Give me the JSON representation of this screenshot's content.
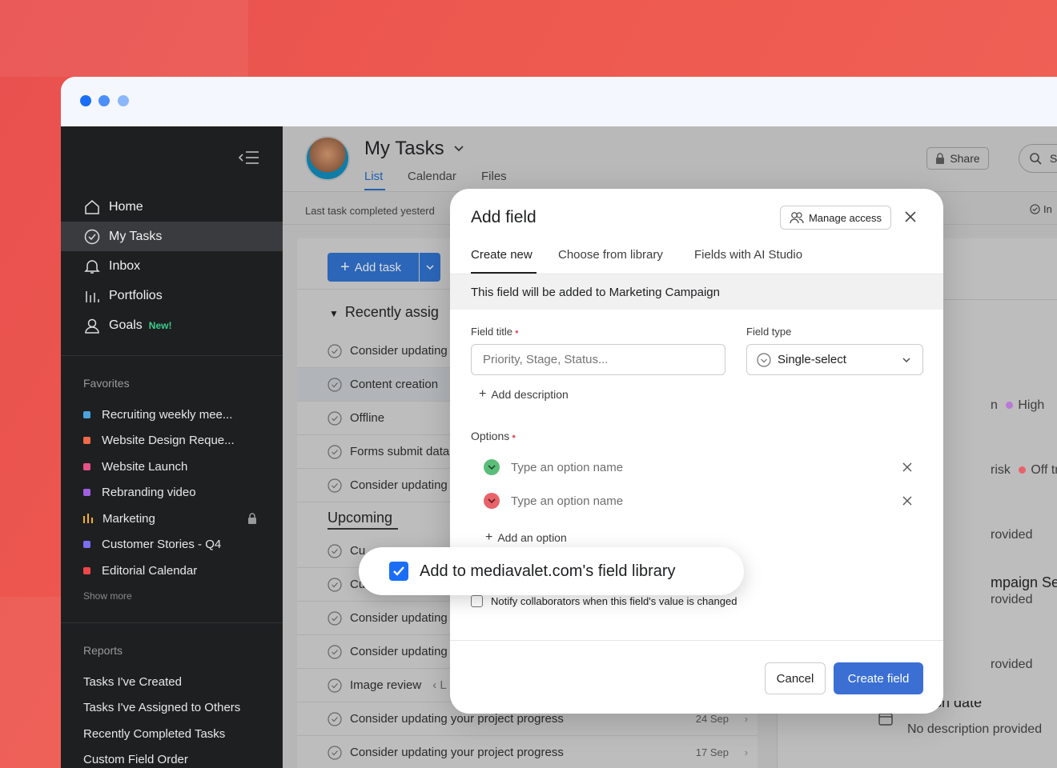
{
  "window": {
    "dots": [
      "#1a6ef5",
      "#4b8ff7",
      "#8bb6fa"
    ]
  },
  "sidebar": {
    "nav": [
      {
        "label": "Home",
        "icon": "home-icon"
      },
      {
        "label": "My Tasks",
        "icon": "check-circle-icon",
        "active": true
      },
      {
        "label": "Inbox",
        "icon": "bell-icon"
      },
      {
        "label": "Portfolios",
        "icon": "bar-chart-icon"
      },
      {
        "label": "Goals",
        "icon": "person-icon",
        "badge": "New!"
      }
    ],
    "favorites_title": "Favorites",
    "favorites": [
      {
        "label": "Recruiting weekly mee...",
        "color": "#4aa3df"
      },
      {
        "label": "Website Design Reque...",
        "color": "#f06a4a"
      },
      {
        "label": "Website Launch",
        "color": "#e8508a"
      },
      {
        "label": "Rebranding video",
        "color": "#a160e0"
      },
      {
        "label": "Marketing",
        "color": "#f5b11e",
        "icon": "bar-chart-icon",
        "locked": true
      },
      {
        "label": "Customer Stories - Q4",
        "color": "#7a6ff0"
      },
      {
        "label": "Editorial Calendar",
        "color": "#f0464a"
      }
    ],
    "show_more": "Show more",
    "reports_title": "Reports",
    "reports": [
      "Tasks I've Created",
      "Tasks I've Assigned to Others",
      "Recently Completed Tasks",
      "Custom Field Order"
    ]
  },
  "header": {
    "title": "My Tasks",
    "tabs": [
      "List",
      "Calendar",
      "Files"
    ],
    "share": "Share",
    "search_partial": "S",
    "last_task": "Last task completed yesterd",
    "right_partial": "In"
  },
  "list": {
    "add_task": "Add task",
    "group1": "Recently assig",
    "tasks1": [
      "Consider updating",
      "Content creation",
      "Offline",
      "Forms submit data",
      "Consider updating"
    ],
    "group2": "Upcoming",
    "tasks2": [
      {
        "name": "Cu"
      },
      {
        "name": "Cu"
      },
      {
        "name": "Consider updating"
      },
      {
        "name": "Consider updating"
      },
      {
        "name": "Image review",
        "extra": "‹ L"
      },
      {
        "name": "Consider updating your project progress",
        "date": "24 Sep"
      },
      {
        "name": "Consider updating your project progress",
        "date": "17 Sep"
      }
    ]
  },
  "right_panel": {
    "high_prefix": "n",
    "high": "High",
    "risk_prefix": "risk",
    "off_track": "Off track",
    "plus": "+",
    "provided1": "rovided",
    "campaign": "mpaign Season",
    "provided2": "rovided",
    "provided3": "rovided",
    "launch_date": "launch date",
    "no_desc": "No description provided"
  },
  "modal": {
    "title": "Add field",
    "manage_access": "Manage access",
    "tabs": [
      "Create new",
      "Choose from library",
      "Fields with AI Studio"
    ],
    "info": "This field will be added to Marketing Campaign",
    "field_title_label": "Field title",
    "field_title_placeholder": "Priority, Stage, Status...",
    "field_type_label": "Field type",
    "field_type_value": "Single-select",
    "add_description": "Add description",
    "options_label": "Options",
    "options": [
      {
        "placeholder": "Type an option name",
        "color": "#5bbd7a"
      },
      {
        "placeholder": "Type an option name",
        "color": "#e8626a"
      }
    ],
    "add_option": "Add an option",
    "library_checkbox": "Add to mediavalet.com's field library",
    "notify": "Notify collaborators when this field's value is changed",
    "cancel": "Cancel",
    "create": "Create field"
  },
  "colors": {
    "accent": "#3b6fd4",
    "sidebar_bg": "#1e1f21",
    "checkbox": "#1a6ef5"
  }
}
